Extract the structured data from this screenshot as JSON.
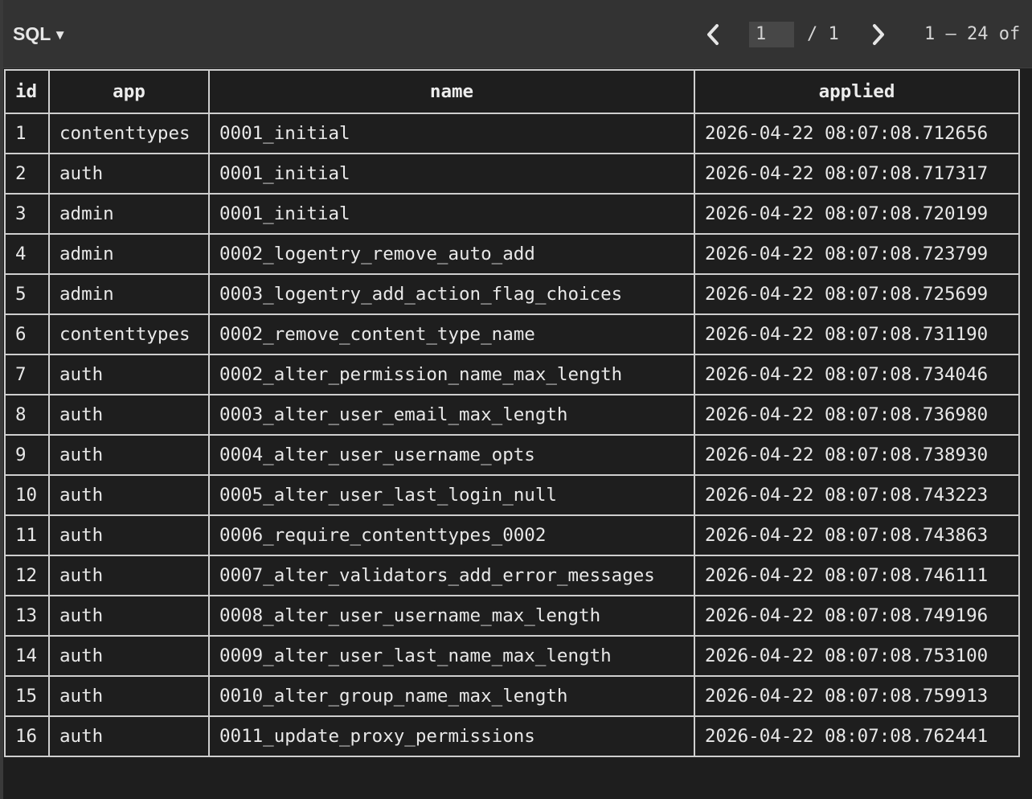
{
  "toolbar": {
    "mode_label": "SQL",
    "mode_caret": "▼",
    "page_current": "1",
    "page_total": "/ 1",
    "range_text": "1 – 24 of"
  },
  "table": {
    "columns": [
      "id",
      "app",
      "name",
      "applied"
    ],
    "rows": [
      [
        "1",
        "contenttypes",
        "0001_initial",
        "2026-04-22 08:07:08.712656"
      ],
      [
        "2",
        "auth",
        "0001_initial",
        "2026-04-22 08:07:08.717317"
      ],
      [
        "3",
        "admin",
        "0001_initial",
        "2026-04-22 08:07:08.720199"
      ],
      [
        "4",
        "admin",
        "0002_logentry_remove_auto_add",
        "2026-04-22 08:07:08.723799"
      ],
      [
        "5",
        "admin",
        "0003_logentry_add_action_flag_choices",
        "2026-04-22 08:07:08.725699"
      ],
      [
        "6",
        "contenttypes",
        "0002_remove_content_type_name",
        "2026-04-22 08:07:08.731190"
      ],
      [
        "7",
        "auth",
        "0002_alter_permission_name_max_length",
        "2026-04-22 08:07:08.734046"
      ],
      [
        "8",
        "auth",
        "0003_alter_user_email_max_length",
        "2026-04-22 08:07:08.736980"
      ],
      [
        "9",
        "auth",
        "0004_alter_user_username_opts",
        "2026-04-22 08:07:08.738930"
      ],
      [
        "10",
        "auth",
        "0005_alter_user_last_login_null",
        "2026-04-22 08:07:08.743223"
      ],
      [
        "11",
        "auth",
        "0006_require_contenttypes_0002",
        "2026-04-22 08:07:08.743863"
      ],
      [
        "12",
        "auth",
        "0007_alter_validators_add_error_messages",
        "2026-04-22 08:07:08.746111"
      ],
      [
        "13",
        "auth",
        "0008_alter_user_username_max_length",
        "2026-04-22 08:07:08.749196"
      ],
      [
        "14",
        "auth",
        "0009_alter_user_last_name_max_length",
        "2026-04-22 08:07:08.753100"
      ],
      [
        "15",
        "auth",
        "0010_alter_group_name_max_length",
        "2026-04-22 08:07:08.759913"
      ],
      [
        "16",
        "auth",
        "0011_update_proxy_permissions",
        "2026-04-22 08:07:08.762441"
      ]
    ]
  },
  "icons": {
    "prev": "chevron-left-icon",
    "next": "chevron-right-icon",
    "mode_caret": "caret-down-icon"
  },
  "colors": {
    "background": "#1e1e1e",
    "toolbar": "#333333",
    "grid_lines": "#cfcfcf",
    "text": "#e8e8e8"
  }
}
